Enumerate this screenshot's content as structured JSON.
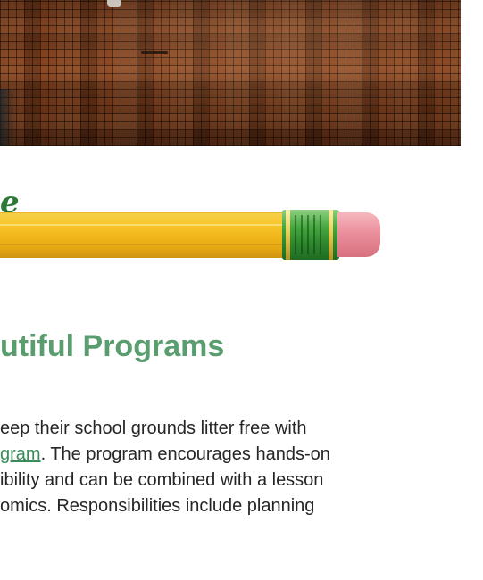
{
  "heading": "utiful Programs",
  "banner": {
    "script_letter": "e"
  },
  "paragraph": {
    "line1": "eep their school grounds litter free with",
    "line2_link": "gram",
    "line2_rest": ". The program encourages hands-on",
    "line3": "ibility and can be combined with a lesson",
    "line4": "omics.  Responsibilities include planning"
  },
  "colors": {
    "heading": "#5a9e6f",
    "link": "#3a8d59",
    "body_text": "#262626",
    "script_letter": "#2c7a35",
    "pencil_body": "#f7c72d",
    "ferrule": "#44a83f",
    "eraser": "#eb8f9c"
  },
  "icons": {
    "banner": "pencil-icon"
  }
}
